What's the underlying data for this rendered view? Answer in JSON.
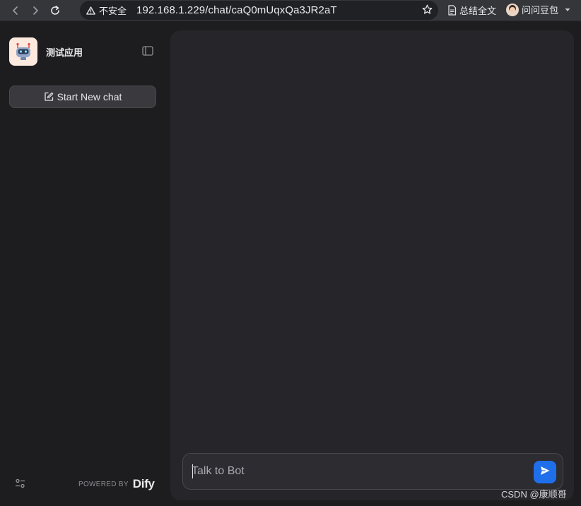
{
  "browser": {
    "security_label": "不安全",
    "url": "192.168.1.229/chat/caQ0mUqxQa3JR2aT",
    "summary_label": "总结全文",
    "profile_name": "问问豆包",
    "icons": {
      "back": "arrow-left-icon",
      "forward": "arrow-right-icon",
      "reload": "reload-icon",
      "warning": "warning-icon",
      "bookmark": "star-icon",
      "summary": "document-icon",
      "profile_menu": "caret-down-icon"
    }
  },
  "sidebar": {
    "app_name": "测试应用",
    "new_chat_label": "Start New chat",
    "powered_by": "POWERED BY",
    "brand": "Dify",
    "icons": {
      "app": "robot-icon",
      "collapse": "sidebar-collapse-icon",
      "new_chat": "edit-icon",
      "settings": "settings-sliders-icon"
    }
  },
  "composer": {
    "placeholder": "Talk to Bot",
    "value": "",
    "send_icon": "send-icon"
  },
  "watermark": "CSDN @康顺哥",
  "colors": {
    "background": "#1d1d20",
    "panel": "#26262a",
    "accent": "#1f6feb",
    "app_icon_bg": "#fde9dd"
  }
}
